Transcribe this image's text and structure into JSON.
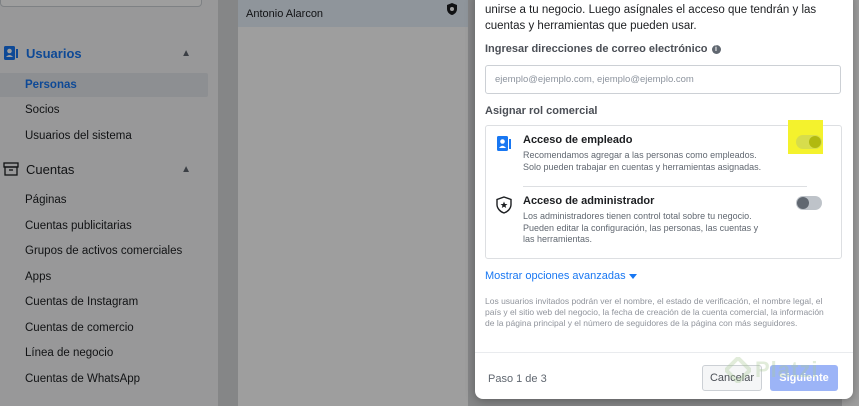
{
  "sidebar": {
    "sections": [
      {
        "label": "Usuarios",
        "icon": "users-icon",
        "items": [
          "Personas",
          "Socios",
          "Usuarios del sistema"
        ],
        "active_item": "Personas"
      },
      {
        "label": "Cuentas",
        "icon": "folder-icon",
        "items": [
          "Páginas",
          "Cuentas publicitarias",
          "Grupos de activos comerciales",
          "Apps",
          "Cuentas de Instagram",
          "Cuentas de comercio",
          "Línea de negocio",
          "Cuentas de WhatsApp"
        ]
      }
    ]
  },
  "people_list": {
    "rows": [
      "Antonio Alarcon"
    ]
  },
  "modal": {
    "intro": "unirse a tu negocio. Luego asígnales el acceso que tendrán y las cuentas y herramientas que pueden usar.",
    "email_label": "Ingresar direcciones de correo electrónico",
    "email_placeholder": "ejemplo@ejemplo.com, ejemplo@ejemplo.com",
    "role_label": "Asignar rol comercial",
    "roles": [
      {
        "title": "Acceso de empleado",
        "description": "Recomendamos agregar a las personas como empleados. Solo pueden trabajar en cuentas y herramientas asignadas.",
        "icon": "employee-badge-icon",
        "enabled": true
      },
      {
        "title": "Acceso de administrador",
        "description": "Los administradores tienen control total sobre tu negocio. Pueden editar la configuración, las personas, las cuentas y las herramientas.",
        "icon": "admin-shield-icon",
        "enabled": false
      }
    ],
    "advanced_link": "Mostrar opciones avanzadas",
    "disclaimer": "Los usuarios invitados podrán ver el nombre, el estado de verificación, el nombre legal, el país y el sitio web del negocio, la fecha de creación de la cuenta comercial, la información de la página principal y el número de seguidores de la página con más seguidores.",
    "step": "Paso 1 de 3",
    "cancel_label": "Cancelar",
    "next_label": "Siguiente"
  },
  "watermark": {
    "text": "Platzi"
  },
  "colors": {
    "accent": "#1877f2",
    "highlight": "#f4f22d",
    "next_button": "#9cb4f7"
  }
}
